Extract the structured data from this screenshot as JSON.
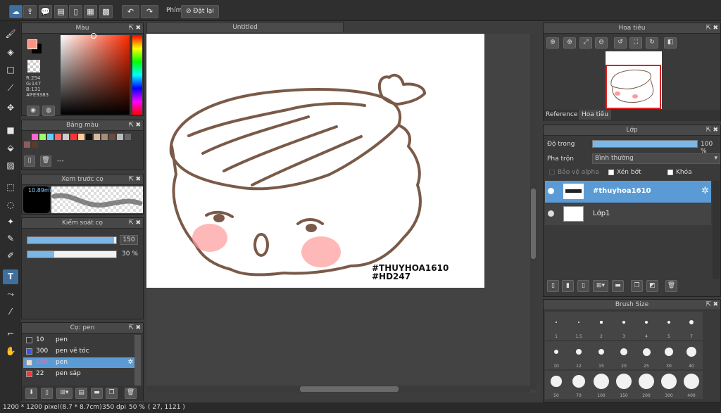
{
  "toolbar": {
    "key_label": "Phím",
    "reset_label": "Đặt lại"
  },
  "color_panel": {
    "title": "Màu",
    "rgb": {
      "r": "R:254",
      "g": "G:147",
      "b": "B:131",
      "hex": "#FE9383"
    },
    "current_color": "#FE9383"
  },
  "palette_panel": {
    "title": "Bảng màu",
    "swatches": [
      "#3b3b3b",
      "#ff66cc",
      "#99ff66",
      "#66ccff",
      "#ff6666",
      "#cccccc",
      "#ff3333",
      "#ffcc99",
      "#111111",
      "#d8b89a",
      "#a88b74",
      "#6b4b3b",
      "#bbbbbb",
      "#666666",
      "#8e5a5a",
      "#5b3b2b"
    ],
    "dash_label": "---"
  },
  "brush_preview_panel": {
    "title": "Xem trước cọ",
    "size_label": "10.89mm"
  },
  "brush_control_panel": {
    "title": "Kiểm soát cọ",
    "size_value": "150",
    "size_fraction": 0.98,
    "opacity_value": "30 %",
    "opacity_fraction": 0.3
  },
  "brush_list_panel": {
    "title": "Cọ: pen",
    "items": [
      {
        "size": "10",
        "name": "pen",
        "color": "#333333",
        "selected": false
      },
      {
        "size": "300",
        "name": "pen vẽ tóc",
        "color": "#3355ff",
        "selected": false
      },
      {
        "size": "150",
        "name": "pen",
        "color": "#dddddd",
        "selected": true
      },
      {
        "size": "22",
        "name": "pen sáp",
        "color": "#ff3333",
        "selected": false
      }
    ]
  },
  "canvas": {
    "tab_title": "Untitled",
    "watermark_line1": "#THUYHOA1610",
    "watermark_line2": "#HD247"
  },
  "navigator_panel": {
    "title": "Hoa tiêu",
    "tabs": [
      "Reference",
      "Hoa tiêu"
    ]
  },
  "layer_panel": {
    "title": "Lớp",
    "opacity_label": "Độ trong",
    "opacity_value": "100 %",
    "opacity_fraction": 1.0,
    "blend_label": "Pha trộn",
    "blend_value": "Bình thường",
    "protect_alpha": "Bảo vệ alpha",
    "clipping": "Xén bớt",
    "lock": "Khóa",
    "layers": [
      {
        "name": "#thuyhoa1610",
        "selected": true
      },
      {
        "name": "Lớp1",
        "selected": false
      }
    ]
  },
  "brush_size_panel": {
    "title": "Brush Size",
    "sizes": [
      "1",
      "1.5",
      "2",
      "3",
      "4",
      "5",
      "7",
      "10",
      "12",
      "15",
      "20",
      "25",
      "30",
      "40",
      "50",
      "70",
      "100",
      "150",
      "200",
      "300",
      "400"
    ]
  },
  "status_bar": {
    "dimensions": "1200 * 1200 pixel",
    "physical": "(8.7 * 8.7cm)",
    "dpi": "350 dpi",
    "zoom": "50 %",
    "coords": "( 27, 1121 )"
  }
}
